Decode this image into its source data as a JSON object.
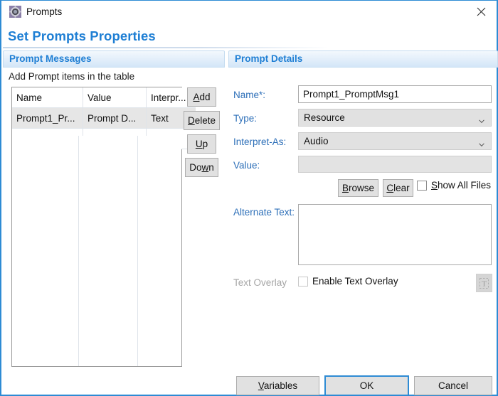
{
  "window": {
    "title": "Prompts",
    "icon": "prompts-gear-icon",
    "close_label": "Close",
    "accent_color": "#2e8bd4"
  },
  "page": {
    "heading": "Set Prompts Properties",
    "heading_color": "#1f7fd4"
  },
  "left_panel": {
    "header": "Prompt Messages",
    "subtitle": "Add Prompt items in the table",
    "table": {
      "columns": [
        "Name",
        "Value",
        "Interpr..."
      ],
      "rows": [
        {
          "name": "Prompt1_Pr...",
          "value": "Prompt D...",
          "interpret": "Text",
          "selected": true
        }
      ]
    },
    "buttons": [
      {
        "id": "add",
        "label": "Add",
        "mnemonic": "A"
      },
      {
        "id": "delete",
        "label": "Delete",
        "mnemonic": "D"
      },
      {
        "id": "up",
        "label": "Up",
        "mnemonic": "U"
      },
      {
        "id": "down",
        "label": "Down",
        "mnemonic": "w"
      }
    ]
  },
  "right_panel": {
    "header": "Prompt Details",
    "fields": {
      "name_label": "Name*:",
      "name_value": "Prompt1_PromptMsg1",
      "type_label": "Type:",
      "type_value": "Resource",
      "type_options": [
        "Resource"
      ],
      "interpret_label": "Interpret-As:",
      "interpret_value": "Audio",
      "interpret_options": [
        "Audio"
      ],
      "value_label": "Value:",
      "value_value": "",
      "alternate_label": "Alternate Text:",
      "alternate_value": "",
      "text_overlay_label": "Text Overlay"
    },
    "buttons": {
      "browse": "Browse",
      "browse_mnemonic": "B",
      "clear": "Clear",
      "clear_mnemonic": "C",
      "text_format_icon": "text-format-icon",
      "text_format_glyph": "T"
    },
    "checkboxes": {
      "show_all_files": "Show All Files",
      "show_all_files_mnemonic": "S",
      "show_all_files_checked": false,
      "enable_text_overlay": "Enable Text Overlay",
      "enable_text_overlay_checked": false,
      "enable_text_overlay_disabled": true
    }
  },
  "footer": {
    "variables": "Variables",
    "variables_mnemonic": "V",
    "ok": "OK",
    "cancel": "Cancel",
    "default_button": "ok"
  }
}
